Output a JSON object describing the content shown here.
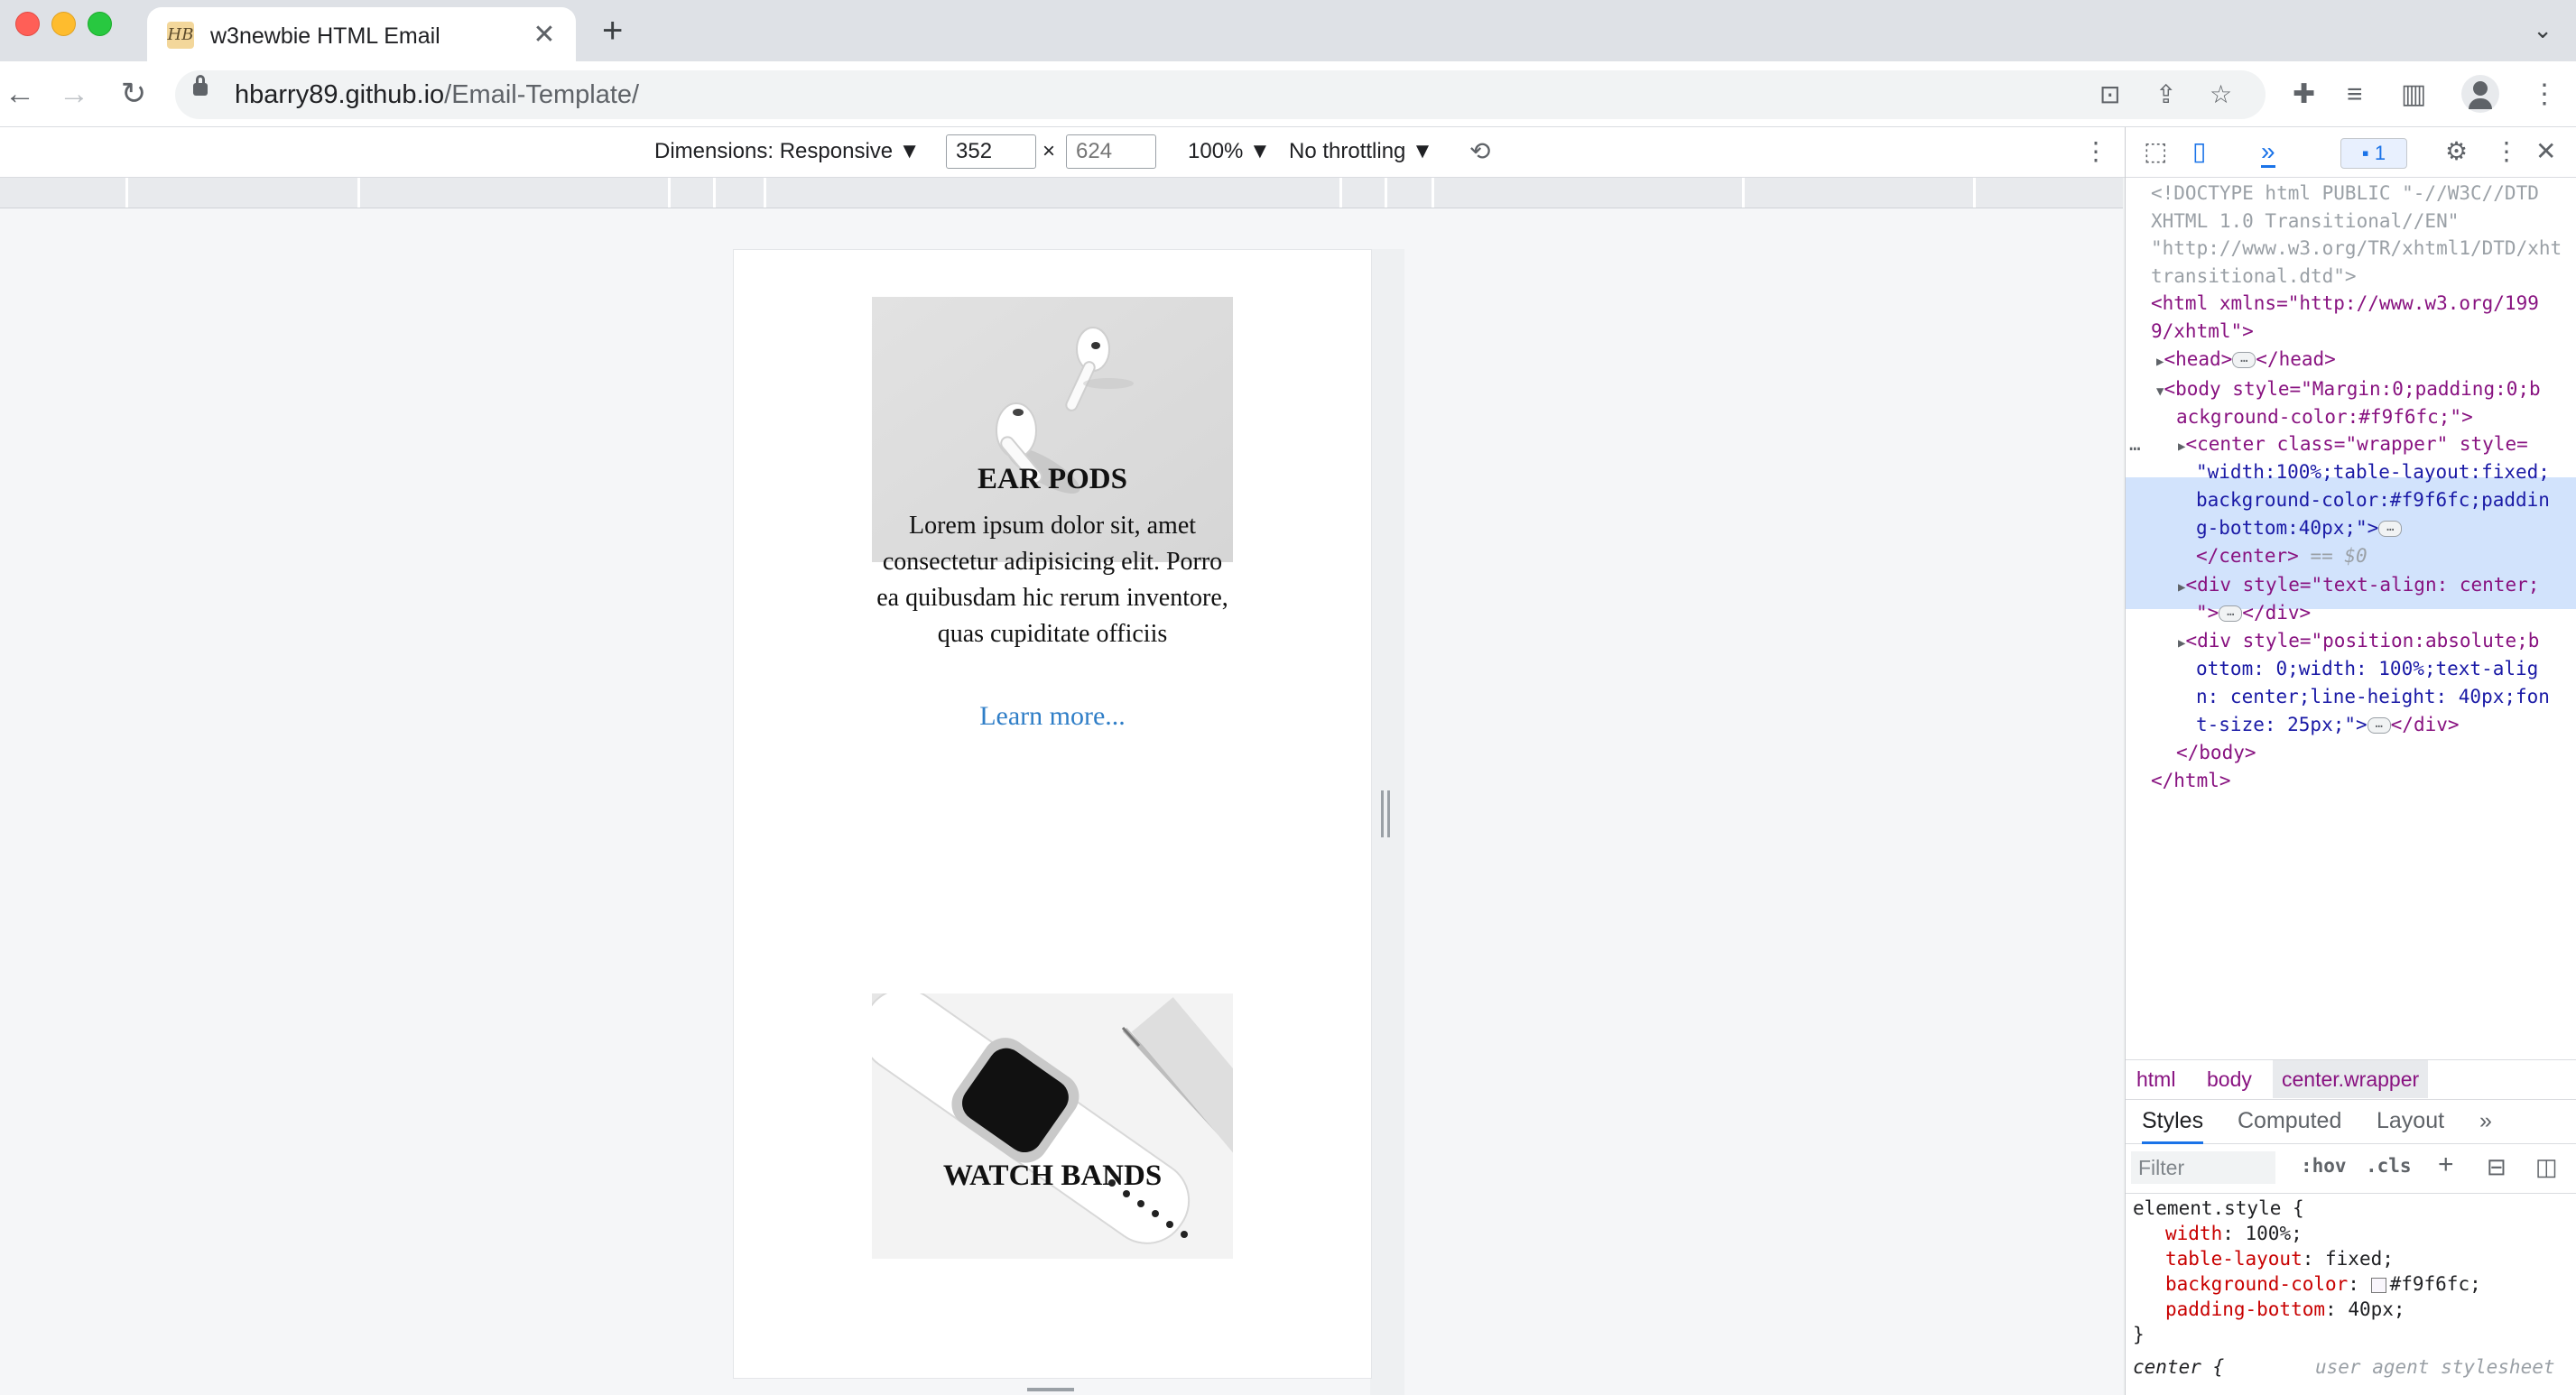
{
  "browser": {
    "tab_title": "w3newbie HTML Email",
    "tab_favicon_text": "HB",
    "url_host": "hbarry89.github.io",
    "url_path": "/Email-Template/"
  },
  "device_toolbar": {
    "dimensions_label": "Dimensions: Responsive ▼",
    "width_value": "352",
    "times": "×",
    "height_placeholder": "624",
    "zoom": "100% ▼",
    "throttling": "No throttling ▼"
  },
  "email": {
    "products": [
      {
        "title": "EAR PODS",
        "description": "Lorem ipsum dolor sit, amet consectetur adipisicing elit. Porro ea quibusdam hic rerum inventore, quas cupiditate officiis",
        "link": "Learn more..."
      },
      {
        "title": "WATCH BANDS"
      }
    ]
  },
  "devtools": {
    "issues_count": "1",
    "dom": [
      "<!DOCTYPE html PUBLIC \"-//W3C//DTD",
      "XHTML 1.0 Transitional//EN\"",
      "\"http://www.w3.org/TR/xhtml1/DTD/xht",
      "transitional.dtd\">"
    ],
    "html_open_1": "<html xmlns=\"http://www.w3.org/199",
    "html_open_2": "9/xhtml\">",
    "head_open": "<head>",
    "head_close": "</head>",
    "body_open_1": "<body style=\"Margin:0;padding:0;b",
    "body_open_2": "ackground-color:#f9f6fc;\">",
    "center_1": "<center class=\"wrapper\" style=",
    "center_2": "\"width:100%;table-layout:fixed;",
    "center_3": "background-color:#f9f6fc;paddin",
    "center_4": "g-bottom:40px;\">",
    "center_close": "</center>",
    "selected_marker": "== $0",
    "div1_open_1": "<div style=\"text-align: center;",
    "div1_open_2": "\">",
    "div_close": "</div>",
    "div2_open_1": "<div style=\"position:absolute;b",
    "div2_open_2": "ottom: 0;width: 100%;text-alig",
    "div2_open_3": "n: center;line-height: 40px;fon",
    "div2_open_4": "t-size: 25px;\">",
    "body_close": "</body>",
    "html_close": "</html>",
    "breadcrumbs": [
      "html",
      "body",
      "center.wrapper"
    ],
    "style_tabs": [
      "Styles",
      "Computed",
      "Layout",
      "»"
    ],
    "filter_placeholder": "Filter",
    "hov": ":hov",
    "cls": ".cls",
    "element_style_selector": "element.style {",
    "styles": [
      {
        "prop": "width",
        "value": "100%;"
      },
      {
        "prop": "table-layout",
        "value": "fixed;"
      },
      {
        "prop": "background-color",
        "value": "#f9f6fc;"
      },
      {
        "prop": "padding-bottom",
        "value": "40px;"
      }
    ],
    "close_brace": "}",
    "center_rule": "center {",
    "user_agent": "user agent stylesheet"
  }
}
